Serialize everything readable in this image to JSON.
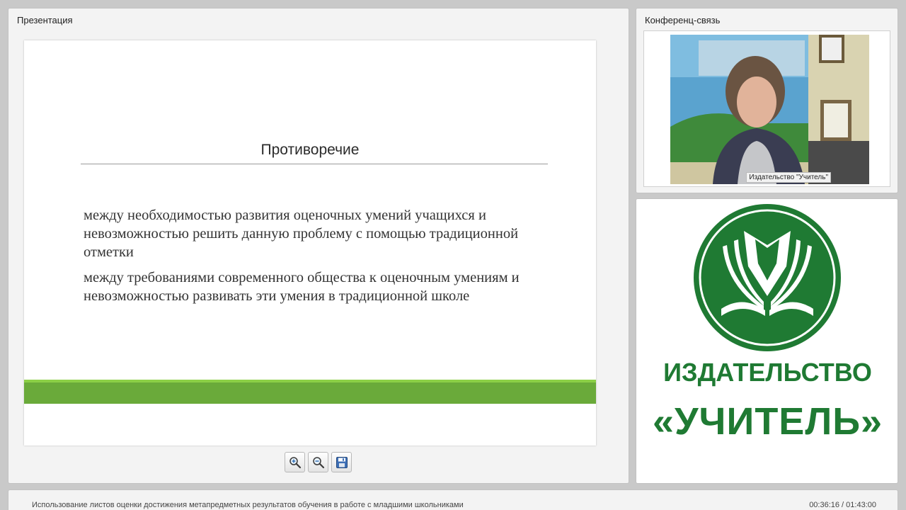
{
  "presentation_panel": {
    "title": "Презентация",
    "slide": {
      "heading": "Противоречие",
      "paragraphs": [
        "между необходимостью развития оценочных умений учащихся и невозможностью решить данную проблему с помощью традиционной отметки",
        "между требованиями современного общества к оценочным умениям и невозможностью развивать эти умения в традиционной школе"
      ]
    },
    "toolbar": {
      "zoom_in_icon": "zoom-in-magnifier",
      "zoom_out_icon": "zoom-out-magnifier",
      "save_icon": "floppy-disk"
    }
  },
  "conference_panel": {
    "title": "Конференц-связь",
    "participant_name": "Издательство \"Учитель\""
  },
  "logo_panel": {
    "line1": "ИЗДАТЕЛЬСТВО",
    "line2": "«УЧИТЕЛЬ»"
  },
  "status_bar": {
    "lecture_title": "Использование листов оценки достижения метапредметных результатов обучения в работе с младшими школьниками",
    "time": "00:36:16 / 01:43:00"
  },
  "colors": {
    "brand_green": "#1f7a33",
    "slide_band_light": "#8bcf46",
    "slide_band": "#6aaa3a"
  }
}
